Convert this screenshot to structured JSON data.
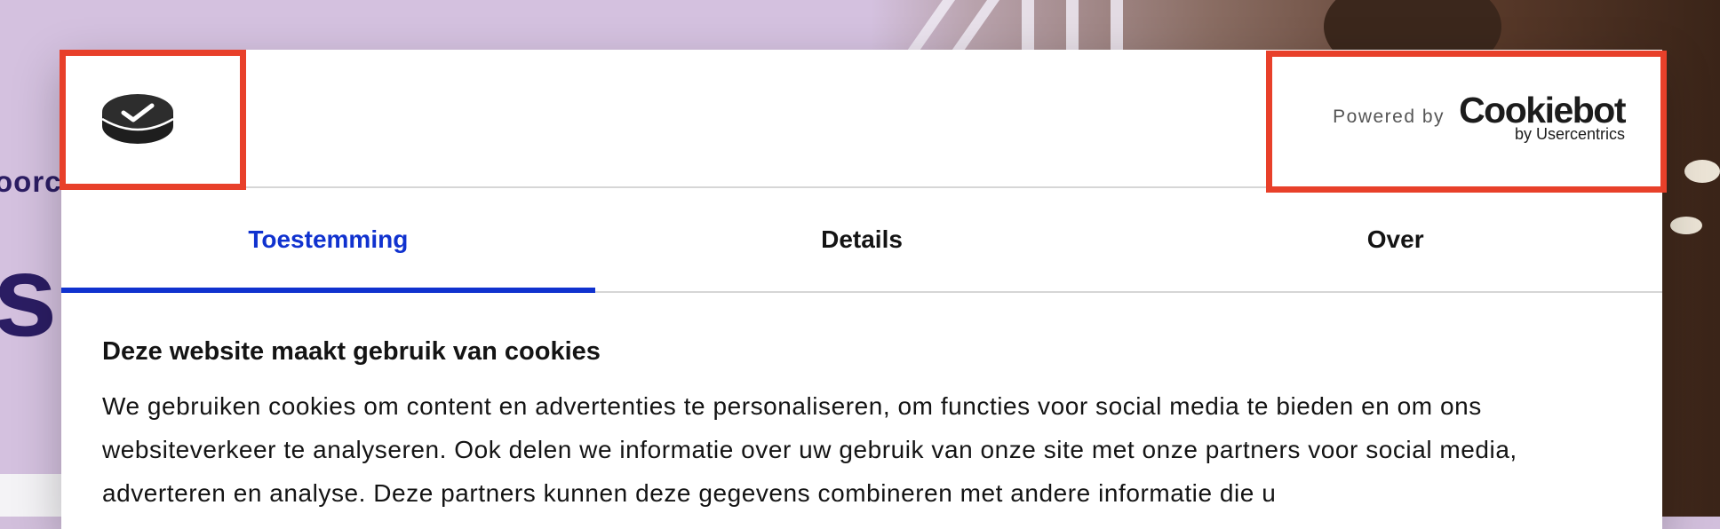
{
  "background": {
    "partial_text_small": "oorc",
    "partial_text_big": "s,"
  },
  "dialog": {
    "logo_icon": "cookie-check-logo-icon",
    "powered_by_label": "Powered by",
    "brand_name": "Cookiebot",
    "brand_sub": "by Usercentrics",
    "tabs": [
      {
        "label": "Toestemming",
        "active": true
      },
      {
        "label": "Details",
        "active": false
      },
      {
        "label": "Over",
        "active": false
      }
    ],
    "heading": "Deze website maakt gebruik van cookies",
    "body": "We gebruiken cookies om content en advertenties te personaliseren, om functies voor social media te bieden en om ons websiteverkeer te analyseren. Ook delen we informatie over uw gebruik van onze site met onze partners voor social media, adverteren en analyse. Deze partners kunnen deze gegevens combineren met andere informatie die u"
  },
  "colors": {
    "accent": "#1032cf",
    "highlight": "#e8402a",
    "background": "#d4c1df"
  }
}
